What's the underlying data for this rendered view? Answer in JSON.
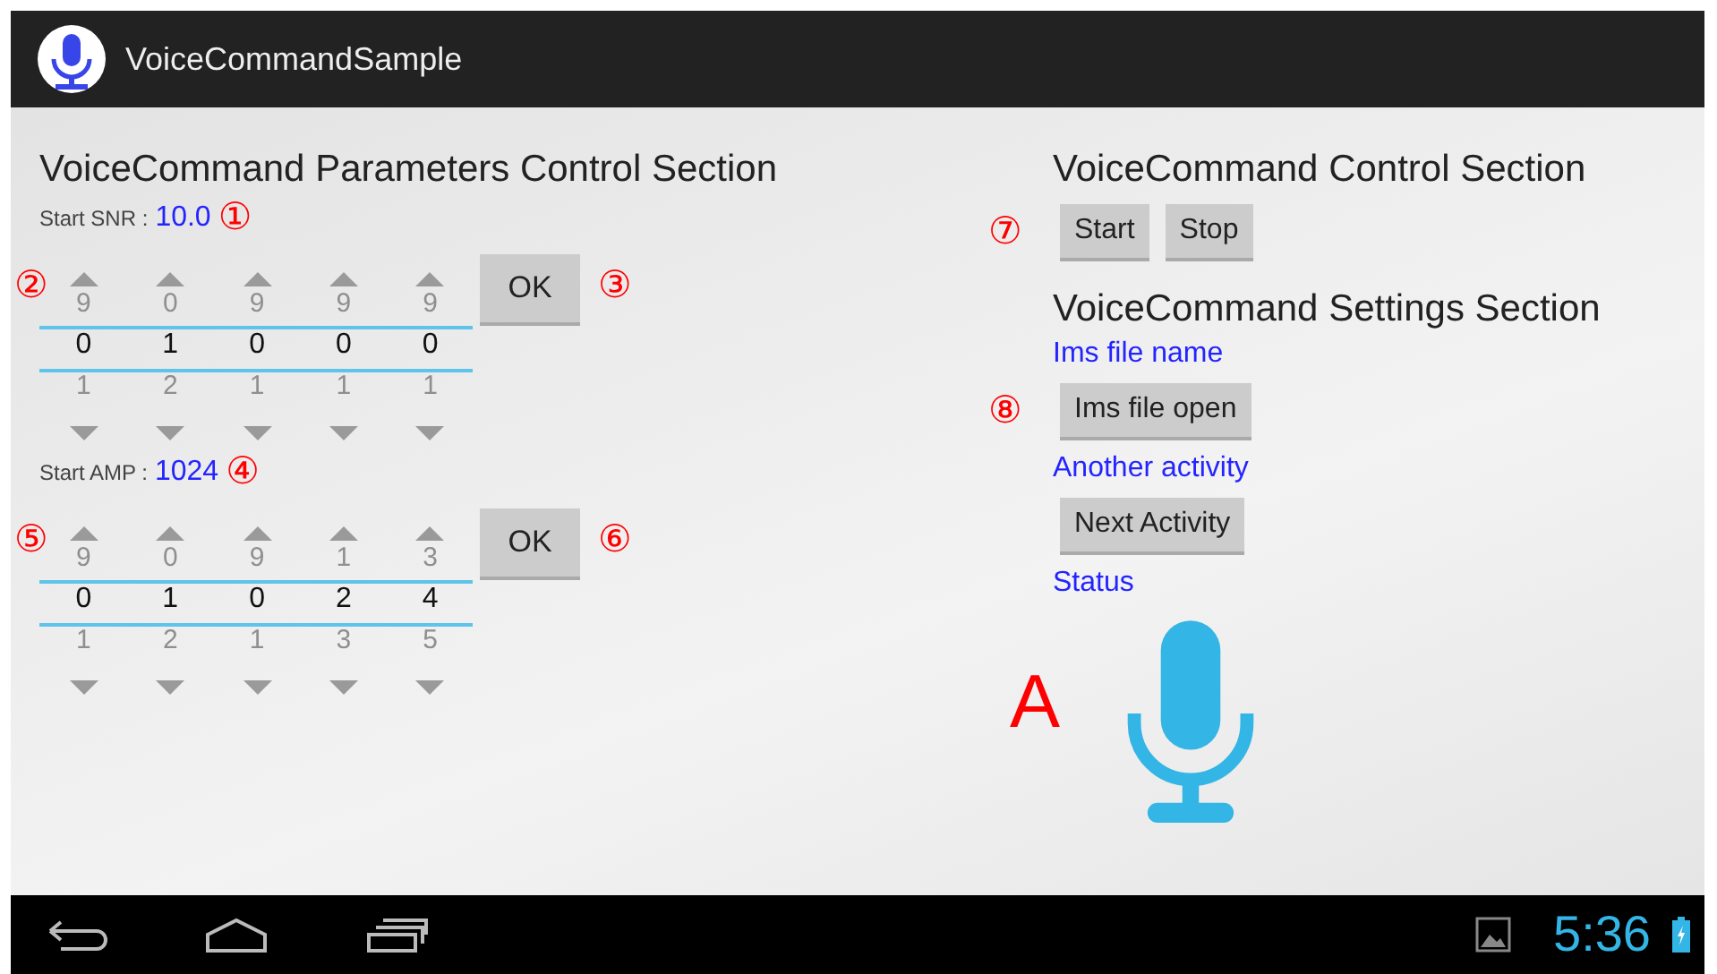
{
  "app_bar": {
    "title": "VoiceCommandSample"
  },
  "parameters_section": {
    "heading": "VoiceCommand Parameters Control Section",
    "fields": [
      {
        "label": "Start SNR :",
        "value": "10.0",
        "marker": "①",
        "picker": {
          "marker": "②",
          "ok": "OK",
          "ok_marker": "③",
          "columns": [
            {
              "above": "9",
              "value": "0",
              "below": "1"
            },
            {
              "above": "0",
              "value": "1",
              "below": "2"
            },
            {
              "above": "9",
              "value": "0",
              "below": "1"
            },
            {
              "above": "9",
              "value": "0",
              "below": "1"
            },
            {
              "above": "9",
              "value": "0",
              "below": "1"
            }
          ]
        }
      },
      {
        "label": "Start AMP :",
        "value": "1024",
        "marker": "④",
        "picker": {
          "marker": "⑤",
          "ok": "OK",
          "ok_marker": "⑥",
          "columns": [
            {
              "above": "9",
              "value": "0",
              "below": "1"
            },
            {
              "above": "0",
              "value": "1",
              "below": "2"
            },
            {
              "above": "9",
              "value": "0",
              "below": "1"
            },
            {
              "above": "1",
              "value": "2",
              "below": "3"
            },
            {
              "above": "3",
              "value": "4",
              "below": "5"
            }
          ]
        }
      }
    ]
  },
  "control_section": {
    "heading": "VoiceCommand Control Section",
    "marker": "⑦",
    "buttons": [
      "Start",
      "Stop"
    ]
  },
  "settings_section": {
    "heading": "VoiceCommand Settings Section",
    "file_label": "Ims file name",
    "marker": "⑧",
    "file_button": "Ims file open",
    "activity_label": "Another activity",
    "activity_button": "Next Activity",
    "status_label": "Status",
    "mic_marker": "A"
  },
  "nav_bar": {
    "time": "5:36"
  }
}
